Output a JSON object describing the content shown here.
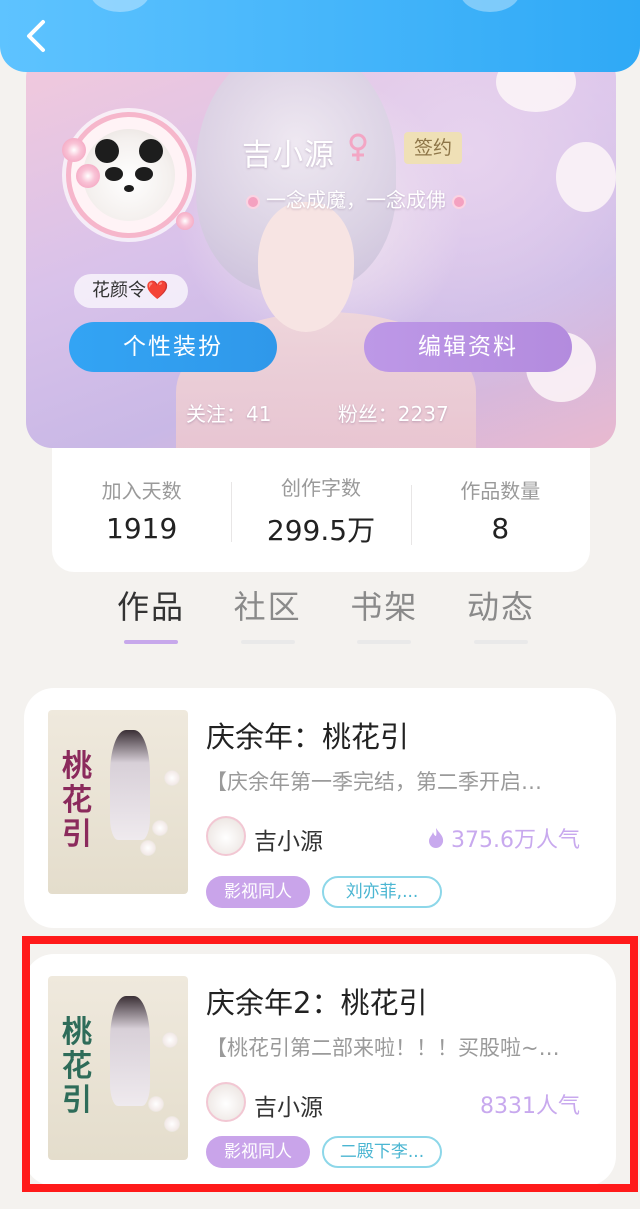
{
  "header": {
    "back_icon": "chevron-left-icon"
  },
  "profile": {
    "name": "吉小源",
    "gender_icon": "female-icon",
    "badge": "签约",
    "motto": "一念成魔，一念成佛",
    "title_tag": "花颜令❤️",
    "dress_button": "个性装扮",
    "edit_button": "编辑资料",
    "following": "关注：41",
    "followers": "粉丝：2237"
  },
  "stats": [
    {
      "label": "加入天数",
      "value": "1919"
    },
    {
      "label": "创作字数",
      "value": "299.5万"
    },
    {
      "label": "作品数量",
      "value": "8"
    }
  ],
  "tabs": [
    {
      "label": "作品",
      "active": true
    },
    {
      "label": "社区",
      "active": false
    },
    {
      "label": "书架",
      "active": false
    },
    {
      "label": "动态",
      "active": false
    }
  ],
  "works": [
    {
      "title": "庆余年：桃花引",
      "cover_text": "桃花引",
      "description": "【庆余年第一季完结，第二季开启…",
      "author": "吉小源",
      "popularity": "375.6万人气",
      "popularity_icon": "flame-icon",
      "genre_tag": "影视同人",
      "cp_tag": "刘亦菲,..."
    },
    {
      "title": "庆余年2：桃花引",
      "cover_text": "桃花引",
      "description": "【桃花引第二部来啦！！！买股啦~…",
      "author": "吉小源",
      "popularity": "8331人气",
      "popularity_icon": "",
      "genre_tag": "影视同人",
      "cp_tag": "二殿下李..."
    }
  ],
  "colors": {
    "topbar": "#2fa9f6",
    "dress_button": "#2f98ea",
    "edit_button": "#b38bde",
    "accent_purple": "#c8a9ee",
    "highlight_border": "#ff1a1a"
  }
}
